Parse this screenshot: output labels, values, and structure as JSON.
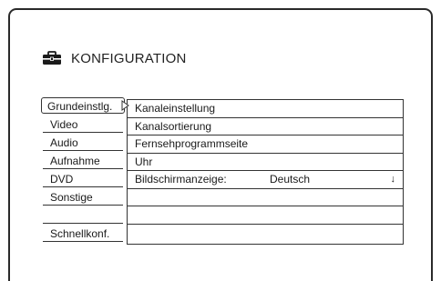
{
  "header": {
    "title": "KONFIGURATION",
    "icon": "toolbox-icon"
  },
  "menu": {
    "items": [
      {
        "label": "Grundeinstlg.",
        "selected": true
      },
      {
        "label": "Video",
        "selected": false
      },
      {
        "label": "Audio",
        "selected": false
      },
      {
        "label": "Aufnahme",
        "selected": false
      },
      {
        "label": "DVD",
        "selected": false
      },
      {
        "label": "Sonstige",
        "selected": false
      },
      {
        "label": "",
        "selected": false
      },
      {
        "label": "Schnellkonf.",
        "selected": false
      }
    ]
  },
  "submenu": {
    "rows": [
      {
        "label": "Kanaleinstellung",
        "value": ""
      },
      {
        "label": "Kanalsortierung",
        "value": ""
      },
      {
        "label": "Fernsehprogrammseite",
        "value": ""
      },
      {
        "label": "Uhr",
        "value": ""
      },
      {
        "label": "Bildschirmanzeige:",
        "value": "Deutsch",
        "arrow": "↓"
      },
      {
        "label": "",
        "value": ""
      },
      {
        "label": "",
        "value": ""
      },
      {
        "label": "",
        "value": ""
      }
    ]
  },
  "colors": {
    "border": "#333333",
    "text": "#1a1a1a",
    "background": "#ffffff"
  }
}
